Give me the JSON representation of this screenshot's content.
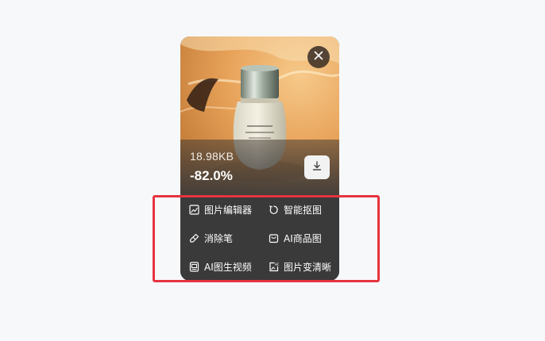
{
  "result_card": {
    "file_size": "18.98KB",
    "compression_ratio": "-82.0%",
    "close_icon": "close-icon",
    "download_icon": "download-icon"
  },
  "tools": [
    {
      "label": "图片编辑器",
      "icon": "image-edit-icon"
    },
    {
      "label": "智能抠图",
      "icon": "cutout-icon"
    },
    {
      "label": "消除笔",
      "icon": "eraser-icon"
    },
    {
      "label": "AI商品图",
      "icon": "product-bag-icon"
    },
    {
      "label": "AI图生视频",
      "icon": "image-to-video-icon"
    },
    {
      "label": "图片变清晰",
      "icon": "hd-image-icon"
    }
  ],
  "colors": {
    "card_background": "#3a3a3a",
    "highlight_border": "#e5343f",
    "page_background": "#f7f8fa"
  }
}
